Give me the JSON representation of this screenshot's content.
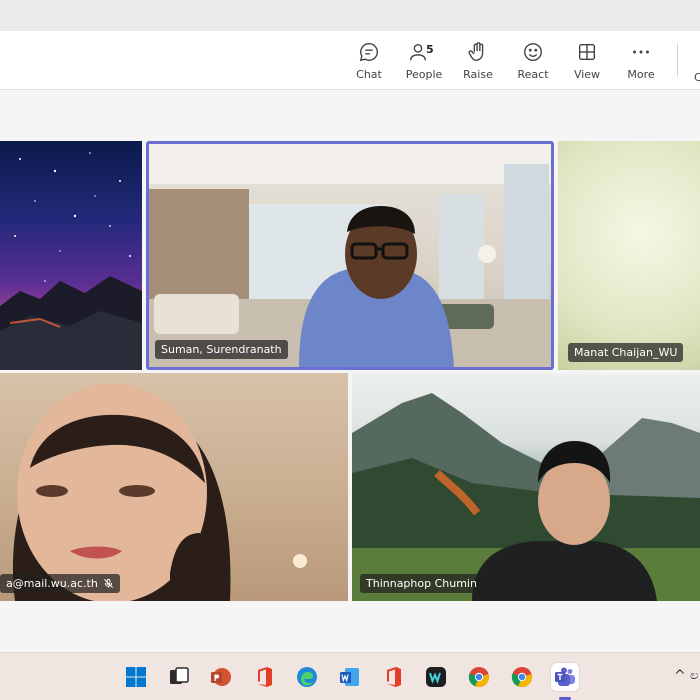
{
  "toolbar": {
    "chat_label": "Chat",
    "people_label": "People",
    "people_count": "5",
    "raise_label": "Raise",
    "react_label": "React",
    "view_label": "View",
    "more_label": "More",
    "cut_label": "C"
  },
  "participants": {
    "p1": {
      "name": ""
    },
    "p2": {
      "name": "Suman, Surendranath"
    },
    "p3": {
      "name": "Manat Chaijan_WU"
    },
    "p4": {
      "name": "a@mail.wu.ac.th"
    },
    "p5": {
      "name": "Thinnaphop Chumin"
    }
  },
  "taskbar": {
    "icons": [
      "windows-start-icon",
      "task-view-icon",
      "powerpoint-icon",
      "office-icon",
      "edge-icon",
      "word-icon",
      "office-icon",
      "app-icon",
      "chrome-icon",
      "chrome-icon",
      "teams-icon"
    ],
    "tray_chevron": "^"
  },
  "colors": {
    "active_speaker_border": "#6a6fd1",
    "teams_accent": "#5b5fc7",
    "toolbar_bg": "#ffffff",
    "taskbar_bg": "#f0e5e0"
  }
}
